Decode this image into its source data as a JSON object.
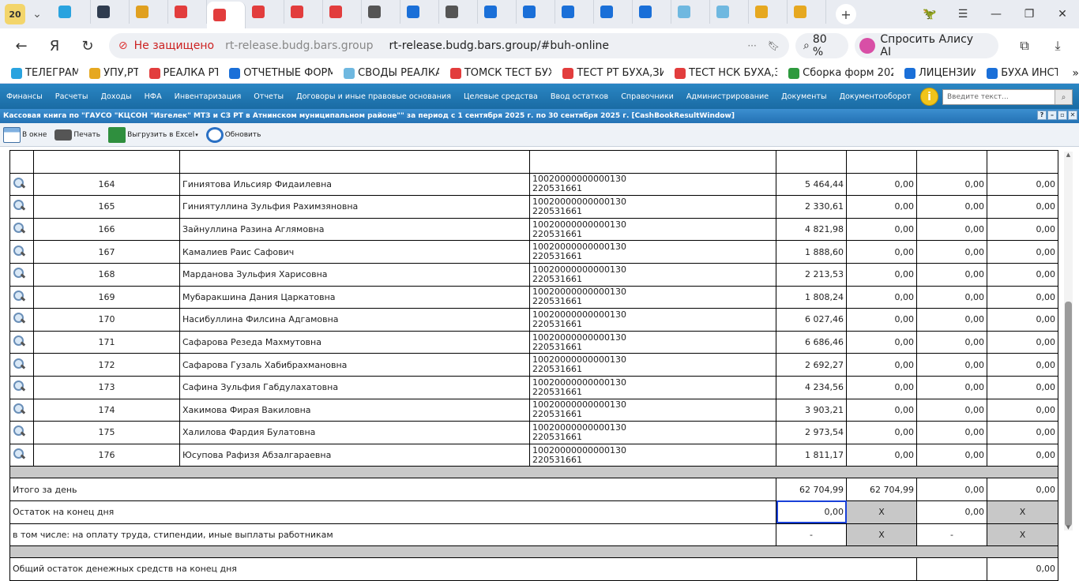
{
  "browser": {
    "tab_count": "20",
    "tabs": [
      {
        "icon": "telegram-icon",
        "color": "#2aa3df"
      },
      {
        "icon": "k-icon",
        "color": "#2f3c4f"
      },
      {
        "icon": "z-icon",
        "color": "#e0a020"
      },
      {
        "icon": "cloud-icon",
        "color": "#e23d3d"
      },
      {
        "icon": "cloud-icon",
        "color": "#e23d3d",
        "active": true
      },
      {
        "icon": "cloud-icon",
        "color": "#e23d3d"
      },
      {
        "icon": "cloud-icon",
        "color": "#e23d3d"
      },
      {
        "icon": "cloud-icon",
        "color": "#e23d3d"
      },
      {
        "icon": "doc-icon",
        "color": "#555555"
      },
      {
        "icon": "x-icon",
        "color": "#1a6fd8"
      },
      {
        "icon": "doc-icon",
        "color": "#555555"
      },
      {
        "icon": "x-icon",
        "color": "#1a6fd8"
      },
      {
        "icon": "x-icon",
        "color": "#1a6fd8"
      },
      {
        "icon": "x-icon",
        "color": "#1a6fd8"
      },
      {
        "icon": "x-icon",
        "color": "#1a6fd8"
      },
      {
        "icon": "x-icon",
        "color": "#1a6fd8"
      },
      {
        "icon": "globe-icon",
        "color": "#6fb8e0"
      },
      {
        "icon": "globe-icon",
        "color": "#6fb8e0"
      },
      {
        "icon": "key-icon",
        "color": "#e6a820"
      },
      {
        "icon": "key-icon",
        "color": "#e6a820"
      }
    ],
    "insecure_label": "Не защищено",
    "host": "rt-release.budg.bars.group",
    "url": "rt-release.budg.bars.group/#buh-online",
    "zoom": "80 %",
    "alice_label": "Спросить Алису AI"
  },
  "bookmarks": [
    {
      "label": "ТЕЛЕГРАМ",
      "color": "#2aa3df"
    },
    {
      "label": "УПУ,РТ",
      "color": "#e6a820"
    },
    {
      "label": "РЕАЛКА РТ",
      "color": "#e23d3d"
    },
    {
      "label": "ОТЧЕТНЫЕ ФОРМ",
      "color": "#1a6fd8"
    },
    {
      "label": "СВОДЫ РЕАЛКА",
      "color": "#6fb8e0"
    },
    {
      "label": "ТОМСК ТЕСТ БУХ",
      "color": "#e23d3d"
    },
    {
      "label": "ТЕСТ РТ БУХА,ЗИ",
      "color": "#e23d3d"
    },
    {
      "label": "ТЕСТ НСК БУХА,З",
      "color": "#e23d3d"
    },
    {
      "label": "Сборка форм 202",
      "color": "#2e9a3e"
    },
    {
      "label": "ЛИЦЕНЗИИ",
      "color": "#1a6fd8"
    },
    {
      "label": "БУХА ИНСТ",
      "color": "#1a6fd8"
    }
  ],
  "app_menu": [
    "Финансы",
    "Расчеты",
    "Доходы",
    "НФА",
    "Инвентаризация",
    "Отчеты",
    "Договоры и иные правовые основания",
    "Целевые средства",
    "Ввод остатков",
    "Справочники",
    "Администрирование",
    "Документы",
    "Документооборот"
  ],
  "global_search_placeholder": "Введите текст...",
  "window_title": "Кассовая книга по \"ГАУСО \"КЦСОН \"Изгелек\" МТЗ и СЗ РТ в Атнинском муниципальном районе\"\" за период с 1 сентября 2025 г. по 30 сентября 2025 г. [CashBookResultWindow]",
  "toolbar": {
    "window_label": "В окне",
    "print_label": "Печать",
    "excel_label": "Выгрузить в Excel",
    "refresh_label": "Обновить"
  },
  "rows": [
    {
      "n": "164",
      "name": "Гиниятова Ильсияр Фидаилевна",
      "acc1": "10020000000000130",
      "acc2": "220531661",
      "v1": "5 464,44",
      "v2": "0,00",
      "v3": "0,00",
      "v4": "0,00"
    },
    {
      "n": "165",
      "name": "Гиниятуллина Зульфия Рахимзяновна",
      "acc1": "10020000000000130",
      "acc2": "220531661",
      "v1": "2 330,61",
      "v2": "0,00",
      "v3": "0,00",
      "v4": "0,00"
    },
    {
      "n": "166",
      "name": "Зайнуллина Разина Аглямовна",
      "acc1": "10020000000000130",
      "acc2": "220531661",
      "v1": "4 821,98",
      "v2": "0,00",
      "v3": "0,00",
      "v4": "0,00"
    },
    {
      "n": "167",
      "name": "Камалиев Раис Сафович",
      "acc1": "10020000000000130",
      "acc2": "220531661",
      "v1": "1 888,60",
      "v2": "0,00",
      "v3": "0,00",
      "v4": "0,00"
    },
    {
      "n": "168",
      "name": "Марданова Зульфия Харисовна",
      "acc1": "10020000000000130",
      "acc2": "220531661",
      "v1": "2 213,53",
      "v2": "0,00",
      "v3": "0,00",
      "v4": "0,00"
    },
    {
      "n": "169",
      "name": "Мубаракшина Дания Царкатовна",
      "acc1": "10020000000000130",
      "acc2": "220531661",
      "v1": "1 808,24",
      "v2": "0,00",
      "v3": "0,00",
      "v4": "0,00"
    },
    {
      "n": "170",
      "name": "Насибуллина Филсина Адгамовна",
      "acc1": "10020000000000130",
      "acc2": "220531661",
      "v1": "6 027,46",
      "v2": "0,00",
      "v3": "0,00",
      "v4": "0,00"
    },
    {
      "n": "171",
      "name": "Сафарова Резеда Махмутовна",
      "acc1": "10020000000000130",
      "acc2": "220531661",
      "v1": "6 686,46",
      "v2": "0,00",
      "v3": "0,00",
      "v4": "0,00"
    },
    {
      "n": "172",
      "name": "Сафарова Гузаль Хабибрахмановна",
      "acc1": "10020000000000130",
      "acc2": "220531661",
      "v1": "2 692,27",
      "v2": "0,00",
      "v3": "0,00",
      "v4": "0,00"
    },
    {
      "n": "173",
      "name": "Сафина Зульфия Габдулахатовна",
      "acc1": "10020000000000130",
      "acc2": "220531661",
      "v1": "4 234,56",
      "v2": "0,00",
      "v3": "0,00",
      "v4": "0,00"
    },
    {
      "n": "174",
      "name": "Хакимова Фирая Вакиловна",
      "acc1": "10020000000000130",
      "acc2": "220531661",
      "v1": "3 903,21",
      "v2": "0,00",
      "v3": "0,00",
      "v4": "0,00"
    },
    {
      "n": "175",
      "name": "Халилова Фардия Булатовна",
      "acc1": "10020000000000130",
      "acc2": "220531661",
      "v1": "2 973,54",
      "v2": "0,00",
      "v3": "0,00",
      "v4": "0,00"
    },
    {
      "n": "176",
      "name": "Юсупова Рафизя Абзалгараевна",
      "acc1": "10020000000000130",
      "acc2": "220531661",
      "v1": "1 811,17",
      "v2": "0,00",
      "v3": "0,00",
      "v4": "0,00"
    }
  ],
  "summary": {
    "total_label": "Итого за день",
    "total_v1": "62 704,99",
    "total_v2": "62 704,99",
    "total_v3": "0,00",
    "total_v4": "0,00",
    "balance_label": "Остаток на конец дня",
    "balance_v1": "0,00",
    "balance_v2": "X",
    "balance_v3": "0,00",
    "balance_v4": "X",
    "incl_label": "в том числе: на оплату труда, стипендии, иные выплаты работникам",
    "incl_v1": "-",
    "incl_v2": "X",
    "incl_v3": "-",
    "incl_v4": "X",
    "overall_label": "Общий остаток денежных средств на конец дня",
    "overall_value": "0,00"
  }
}
